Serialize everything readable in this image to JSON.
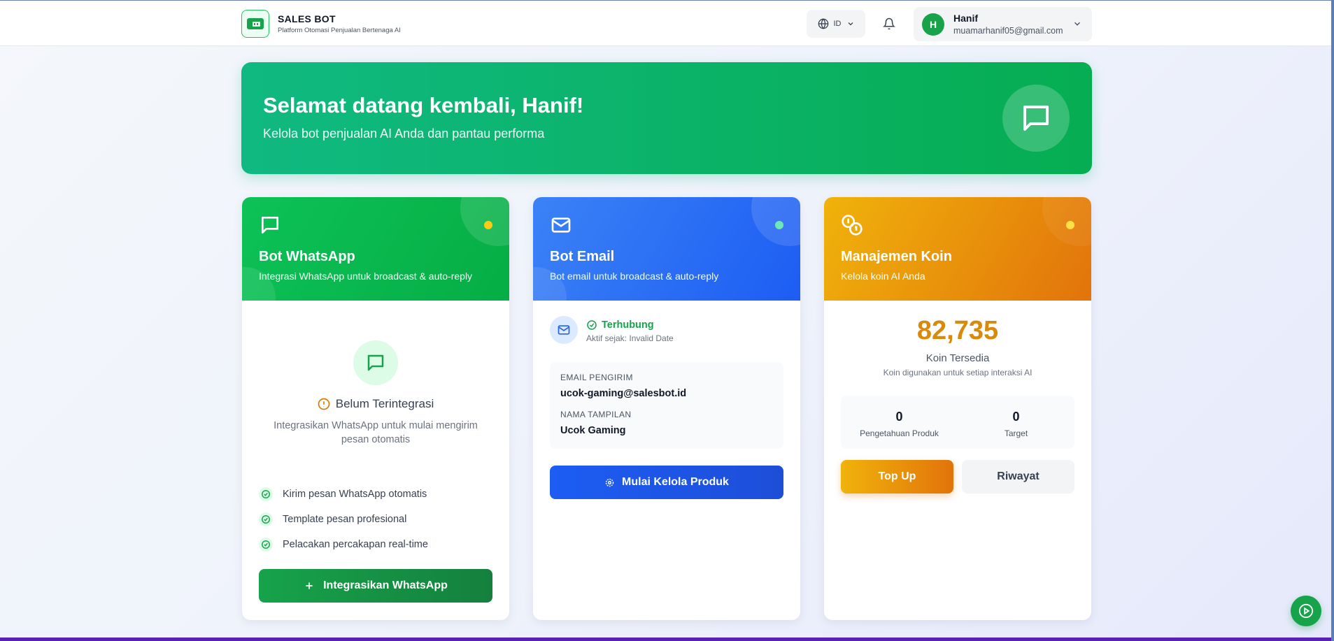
{
  "header": {
    "brand_title": "SALES BOT",
    "brand_subtitle": "Platform Otomasi Penjualan Bertenaga AI",
    "language": "ID",
    "user": {
      "initial": "H",
      "name": "Hanif",
      "email": "muamarhanif05@gmail.com"
    }
  },
  "banner": {
    "title": "Selamat datang kembali, Hanif!",
    "subtitle": "Kelola bot penjualan AI Anda dan pantau performa"
  },
  "whatsapp_card": {
    "title": "Bot WhatsApp",
    "subtitle": "Integrasi WhatsApp untuk broadcast & auto-reply",
    "status": "Belum Terintegrasi",
    "description": "Integrasikan WhatsApp untuk mulai mengirim pesan otomatis",
    "features": [
      "Kirim pesan WhatsApp otomatis",
      "Template pesan profesional",
      "Pelacakan percakapan real-time"
    ],
    "button_label": "Integrasikan WhatsApp"
  },
  "email_card": {
    "title": "Bot Email",
    "subtitle": "Bot email untuk broadcast & auto-reply",
    "status": "Terhubung",
    "active_since": "Aktif sejak: Invalid Date",
    "sender_label": "EMAIL PENGIRIM",
    "sender_value": "ucok-gaming@salesbot.id",
    "display_label": "NAMA TAMPILAN",
    "display_value": "Ucok Gaming",
    "button_label": "Mulai Kelola Produk"
  },
  "coin_card": {
    "title": "Manajemen Koin",
    "subtitle": "Kelola koin AI Anda",
    "amount": "82,735",
    "amount_label": "Koin Tersedia",
    "amount_desc": "Koin digunakan untuk setiap interaksi AI",
    "stats": [
      {
        "value": "0",
        "label": "Pengetahuan Produk"
      },
      {
        "value": "0",
        "label": "Target"
      }
    ],
    "topup_label": "Top Up",
    "history_label": "Riwayat"
  },
  "colors": {
    "green": "#06ad45",
    "blue": "#1d5df3",
    "orange": "#e2730b",
    "coin_amount": "#d98a0b"
  }
}
